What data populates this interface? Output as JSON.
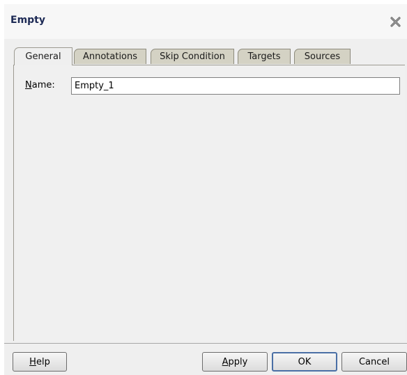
{
  "dialog": {
    "title": "Empty"
  },
  "tabs": [
    {
      "label": "General",
      "active": true
    },
    {
      "label": "Annotations",
      "active": false
    },
    {
      "label": "Skip Condition",
      "active": false
    },
    {
      "label": "Targets",
      "active": false
    },
    {
      "label": "Sources",
      "active": false
    }
  ],
  "general": {
    "name_label_mnemonic": "N",
    "name_label_rest": "ame:",
    "name_value": "Empty_1"
  },
  "buttons": {
    "help_mnemonic": "H",
    "help_rest": "elp",
    "apply_mnemonic": "A",
    "apply_rest": "pply",
    "ok": "OK",
    "cancel": "Cancel"
  },
  "icons": {
    "close": "close-icon"
  },
  "colors": {
    "title_text": "#1d2a55",
    "dialog_bg": "#efefef",
    "inactive_tab": "#d4d2c4",
    "default_button_border": "#4a6fa5"
  }
}
